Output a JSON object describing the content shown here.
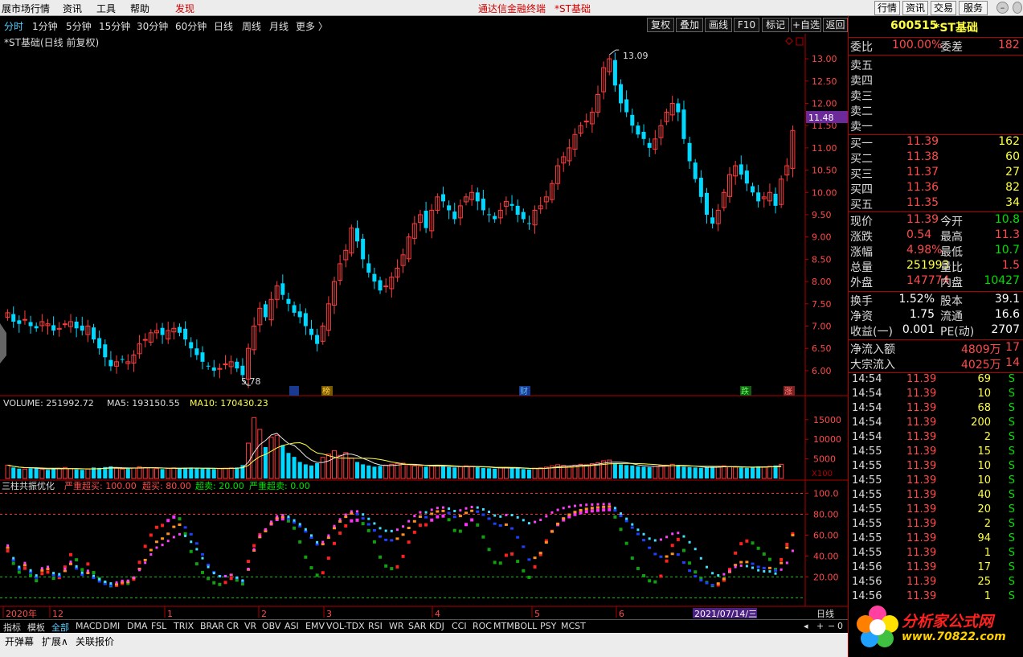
{
  "menubar": {
    "items": [
      "展市场行情",
      "资讯",
      "工具",
      "帮助",
      "发现"
    ],
    "title_app": "通达信金融终端",
    "title_stock": "*ST基础",
    "right_buttons": [
      "行情",
      "资讯",
      "交易",
      "服务"
    ]
  },
  "timeframes": [
    "分时",
    "1分钟",
    "5分钟",
    "15分钟",
    "30分钟",
    "60分钟",
    "日线",
    "周线",
    "月线",
    "更多 〉"
  ],
  "toolbuttons": [
    "复权",
    "叠加",
    "画线",
    "F10",
    "标记",
    "+自选",
    "返回"
  ],
  "main_chart": {
    "title": "*ST基础(日线 前复权)",
    "high_label": "13.09",
    "low_label": "5.78",
    "last_price_tag": "11.48",
    "y_ticks": [
      "13.00",
      "12.50",
      "12.00",
      "11.50",
      "11.00",
      "10.50",
      "10.00",
      "9.50",
      "9.00",
      "8.50",
      "8.00",
      "7.50",
      "7.00",
      "6.50",
      "6.00"
    ],
    "event_markers": [
      "榜",
      "财",
      "跌",
      "涨"
    ]
  },
  "volume": {
    "label": "VOLUME: 251992.72",
    "ma5": "MA5: 193150.55",
    "ma10": "MA10: 170430.23",
    "y_ticks": [
      "15000",
      "10000",
      "5000"
    ],
    "unit": "X100"
  },
  "indicator": {
    "name": "三柱共振优化",
    "p1": "严重超买: 100.00",
    "p2": "超买: 80.00",
    "p3": "超卖: 20.00",
    "p4": "严重超卖: 0.00",
    "y_ticks": [
      "100.0",
      "80.00",
      "60.00",
      "40.00",
      "20.00"
    ]
  },
  "date_axis": {
    "labels": [
      "2020年",
      "12",
      "1",
      "2",
      "3",
      "4",
      "5",
      "6"
    ],
    "cursor_date": "2021/07/14/三",
    "period_label": "日线"
  },
  "bottom_tabs": [
    "指标",
    "模板",
    "全部",
    "MACD",
    "DMI",
    "DMA",
    "FSL",
    "TRIX",
    "BRAR",
    "CR",
    "VR",
    "OBV",
    "ASI",
    "EMV",
    "VOL-TDX",
    "RSI",
    "WR",
    "SAR",
    "KDJ",
    "CCI",
    "ROC",
    "MTM",
    "BOLL",
    "PSY",
    "MCST"
  ],
  "bottom_links": [
    "开弹幕",
    "扩展∧",
    "关联报价"
  ],
  "bottom_nav": [
    "◂",
    "+",
    "−",
    "0"
  ],
  "quote": {
    "code": "600515",
    "name": "*ST基础",
    "weibi_label": "委比",
    "weibi": "100.00%",
    "weicha_label": "委差",
    "weicha": "182",
    "sells": [
      {
        "label": "卖五"
      },
      {
        "label": "卖四"
      },
      {
        "label": "卖三"
      },
      {
        "label": "卖二"
      },
      {
        "label": "卖一"
      }
    ],
    "buys": [
      {
        "label": "买一",
        "price": "11.39",
        "vol": "162"
      },
      {
        "label": "买二",
        "price": "11.38",
        "vol": "60"
      },
      {
        "label": "买三",
        "price": "11.37",
        "vol": "27"
      },
      {
        "label": "买四",
        "price": "11.36",
        "vol": "82"
      },
      {
        "label": "买五",
        "price": "11.35",
        "vol": "34"
      }
    ],
    "stats": [
      {
        "l1": "现价",
        "v1": "11.39",
        "c1": "red",
        "l2": "今开",
        "v2": "10.8",
        "c2": "grn"
      },
      {
        "l1": "涨跌",
        "v1": "0.54",
        "c1": "red",
        "l2": "最高",
        "v2": "11.3",
        "c2": "red"
      },
      {
        "l1": "涨幅",
        "v1": "4.98%",
        "c1": "red",
        "l2": "最低",
        "v2": "10.7",
        "c2": "grn"
      },
      {
        "l1": "总量",
        "v1": "251993",
        "c1": "yel",
        "l2": "量比",
        "v2": "1.5",
        "c2": "red"
      },
      {
        "l1": "外盘",
        "v1": "147774",
        "c1": "red",
        "l2": "内盘",
        "v2": "10427",
        "c2": "grn"
      }
    ],
    "stats2": [
      {
        "l1": "换手",
        "v1": "1.52%",
        "c1": "wht",
        "l2": "股本",
        "v2": "39.1",
        "c2": "wht"
      },
      {
        "l1": "净资",
        "v1": "1.75",
        "c1": "wht",
        "l2": "流通",
        "v2": "16.6",
        "c2": "wht"
      },
      {
        "l1": "收益(一)",
        "v1": "0.001",
        "c1": "wht",
        "l2": "PE(动)",
        "v2": "2707",
        "c2": "wht"
      }
    ],
    "flows": [
      {
        "label": "净流入额",
        "val": "4809万",
        "extra": "17"
      },
      {
        "label": "大宗流入",
        "val": "4025万",
        "extra": "14"
      }
    ],
    "ticks": [
      {
        "t": "14:54",
        "p": "11.39",
        "v": "69",
        "s": "S"
      },
      {
        "t": "14:54",
        "p": "11.39",
        "v": "10",
        "s": "S"
      },
      {
        "t": "14:54",
        "p": "11.39",
        "v": "68",
        "s": "S"
      },
      {
        "t": "14:54",
        "p": "11.39",
        "v": "200",
        "s": "S"
      },
      {
        "t": "14:54",
        "p": "11.39",
        "v": "2",
        "s": "S"
      },
      {
        "t": "14:55",
        "p": "11.39",
        "v": "15",
        "s": "S"
      },
      {
        "t": "14:55",
        "p": "11.39",
        "v": "10",
        "s": "S"
      },
      {
        "t": "14:55",
        "p": "11.39",
        "v": "10",
        "s": "S"
      },
      {
        "t": "14:55",
        "p": "11.39",
        "v": "40",
        "s": "S"
      },
      {
        "t": "14:55",
        "p": "11.39",
        "v": "20",
        "s": "S"
      },
      {
        "t": "14:55",
        "p": "11.39",
        "v": "2",
        "s": "S"
      },
      {
        "t": "14:55",
        "p": "11.39",
        "v": "94",
        "s": "S"
      },
      {
        "t": "14:55",
        "p": "11.39",
        "v": "1",
        "s": "S"
      },
      {
        "t": "14:56",
        "p": "11.39",
        "v": "17",
        "s": "S"
      },
      {
        "t": "14:56",
        "p": "11.39",
        "v": "25",
        "s": "S"
      },
      {
        "t": "14:56",
        "p": "11.39",
        "v": "1",
        "s": "S"
      }
    ]
  },
  "logo": {
    "title": "分析家公式网",
    "url": "www.70822.com"
  },
  "colors": {
    "up": "#ff3c3c",
    "down": "#00d8ff",
    "accent": "#4fd0ff",
    "panel_border": "#b00000",
    "price_tag_bg": "#6a2a9a"
  },
  "chart_data": {
    "type": "candlestick",
    "closes": [
      7.3,
      7.1,
      7.05,
      7.15,
      7.0,
      6.95,
      7.1,
      7.05,
      6.9,
      6.95,
      7.05,
      7.1,
      6.95,
      6.9,
      7.0,
      6.7,
      6.5,
      6.3,
      6.1,
      6.2,
      6.25,
      6.2,
      6.35,
      6.6,
      6.7,
      6.85,
      6.9,
      6.8,
      6.9,
      6.95,
      6.85,
      6.7,
      6.5,
      6.35,
      6.2,
      6.1,
      6.0,
      6.05,
      6.15,
      6.2,
      6.05,
      5.9,
      6.5,
      7.0,
      7.4,
      7.2,
      7.6,
      7.9,
      7.7,
      7.5,
      7.3,
      7.2,
      7.0,
      6.8,
      6.6,
      7.0,
      7.5,
      8.0,
      8.4,
      8.7,
      9.2,
      8.9,
      8.5,
      8.2,
      8.0,
      7.8,
      7.9,
      8.1,
      8.3,
      8.6,
      9.0,
      9.3,
      9.5,
      9.2,
      9.6,
      9.9,
      9.8,
      9.6,
      9.4,
      9.7,
      9.9,
      10.0,
      9.8,
      9.6,
      9.5,
      9.4,
      9.6,
      9.8,
      9.7,
      9.5,
      9.4,
      9.3,
      9.6,
      9.7,
      9.9,
      10.2,
      10.6,
      10.8,
      11.0,
      11.3,
      11.5,
      11.6,
      11.8,
      12.2,
      12.8,
      13.0,
      12.4,
      12.0,
      11.8,
      11.5,
      11.3,
      11.2,
      11.0,
      11.2,
      11.5,
      11.8,
      12.0,
      11.8,
      11.2,
      10.7,
      10.3,
      9.9,
      9.5,
      9.3,
      9.6,
      10.0,
      10.4,
      10.6,
      10.4,
      10.2,
      10.0,
      9.8,
      9.9,
      10.0,
      9.7,
      10.3,
      10.6,
      11.39
    ],
    "high": 13.09,
    "low": 5.78,
    "ylim": [
      5.8,
      13.2
    ],
    "volumes": [
      3400,
      2800,
      2500,
      2400,
      2600,
      2700,
      2300,
      2200,
      2500,
      2600,
      2800,
      2500,
      2300,
      2200,
      2400,
      2800,
      2700,
      2900,
      3100,
      2600,
      2400,
      2500,
      2700,
      3000,
      2800,
      2700,
      2500,
      2400,
      2600,
      2700,
      2500,
      2600,
      2800,
      2700,
      2500,
      2600,
      2400,
      2500,
      2600,
      2700,
      2800,
      3400,
      9000,
      15500,
      12500,
      8000,
      10500,
      11000,
      8500,
      6500,
      5500,
      4200,
      3600,
      3300,
      3900,
      5400,
      6200,
      7100,
      5900,
      6600,
      5200,
      4200,
      3600,
      3300,
      3000,
      3200,
      3400,
      3600,
      3800,
      3900,
      3500,
      3200,
      3100,
      3000,
      3200,
      3300,
      3100,
      2900,
      2800,
      3000,
      3200,
      3100,
      2900,
      2700,
      2600,
      2500,
      2700,
      2800,
      2700,
      2600,
      2400,
      2300,
      2600,
      2700,
      2900,
      3200,
      3500,
      3300,
      3100,
      3400,
      3600,
      3500,
      3800,
      4000,
      4500,
      4700,
      3900,
      3600,
      3400,
      3300,
      3100,
      3000,
      2900,
      3100,
      3300,
      3400,
      3600,
      3400,
      3000,
      2900,
      2800,
      2700,
      2800,
      3000,
      3100,
      3200,
      3000,
      2900,
      2800,
      2700,
      2900,
      3100,
      2900,
      3100,
      3300,
      3600
    ]
  }
}
